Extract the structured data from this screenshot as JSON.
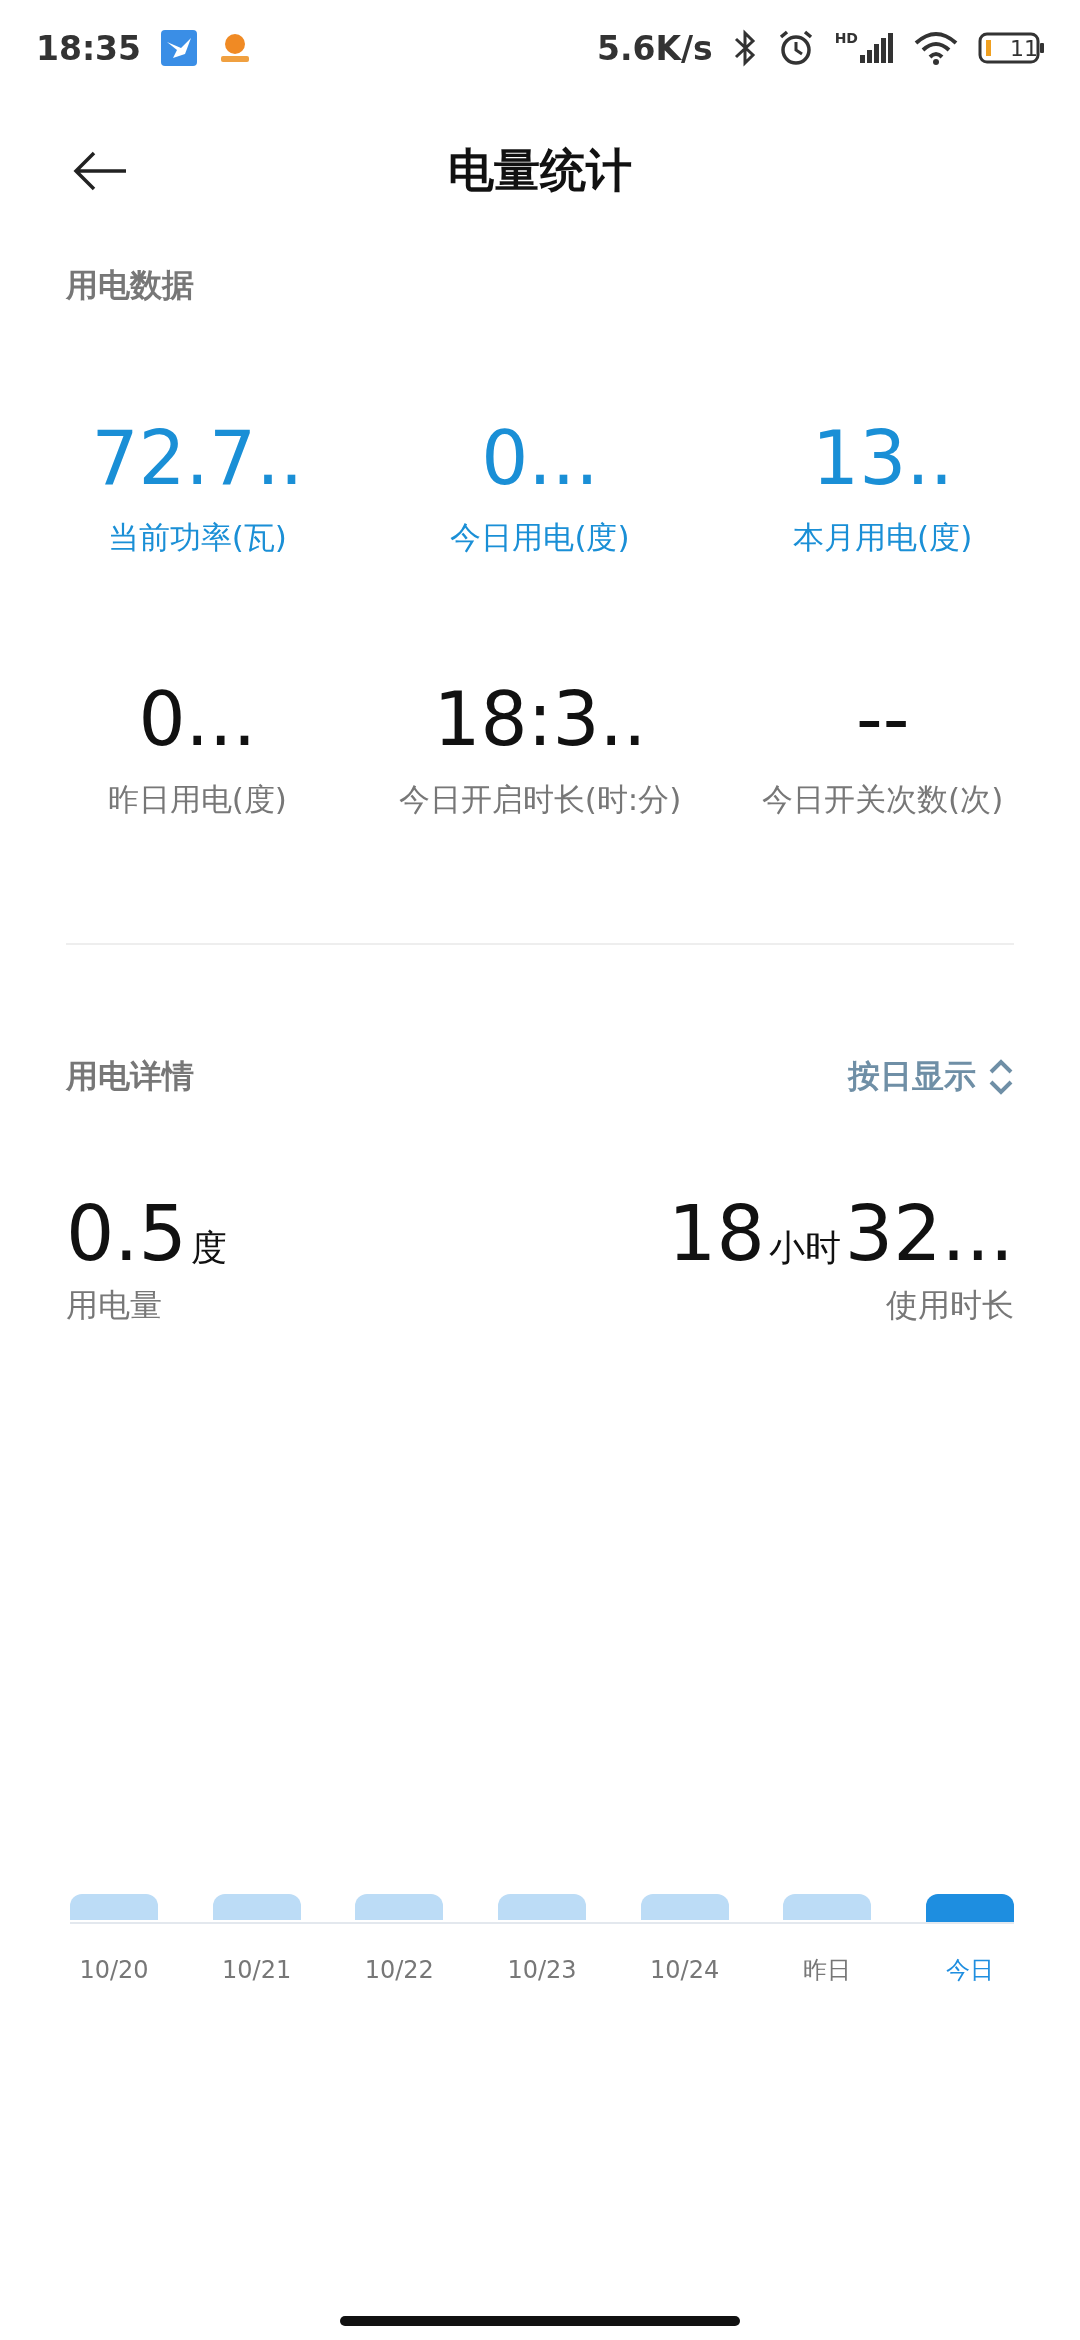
{
  "status_bar": {
    "time": "18:35",
    "speed": "5.6K/s",
    "network_label": "HD",
    "battery": "11"
  },
  "header": {
    "title": "电量统计"
  },
  "usage_data": {
    "title": "用电数据",
    "stats": [
      {
        "value": "72.7..",
        "label": "当前功率(瓦)",
        "highlight": true
      },
      {
        "value": "0...",
        "label": "今日用电(度)",
        "highlight": true
      },
      {
        "value": "13..",
        "label": "本月用电(度)",
        "highlight": true
      },
      {
        "value": "0...",
        "label": "昨日用电(度)",
        "highlight": false
      },
      {
        "value": "18:3..",
        "label": "今日开启时长(时:分)",
        "highlight": false
      },
      {
        "value": "--",
        "label": "今日开关次数(次)",
        "highlight": false
      }
    ]
  },
  "usage_details": {
    "title": "用电详情",
    "mode": "按日显示",
    "energy": {
      "value": "0.5",
      "unit": "度",
      "label": "用电量"
    },
    "duration": {
      "hours": "18",
      "hours_unit": "小时",
      "minutes": "32...",
      "label": "使用时长"
    },
    "days": [
      {
        "label": "10/20",
        "selected": false
      },
      {
        "label": "10/21",
        "selected": false
      },
      {
        "label": "10/22",
        "selected": false
      },
      {
        "label": "10/23",
        "selected": false
      },
      {
        "label": "10/24",
        "selected": false
      },
      {
        "label": "昨日",
        "selected": false
      },
      {
        "label": "今日",
        "selected": true
      }
    ]
  }
}
